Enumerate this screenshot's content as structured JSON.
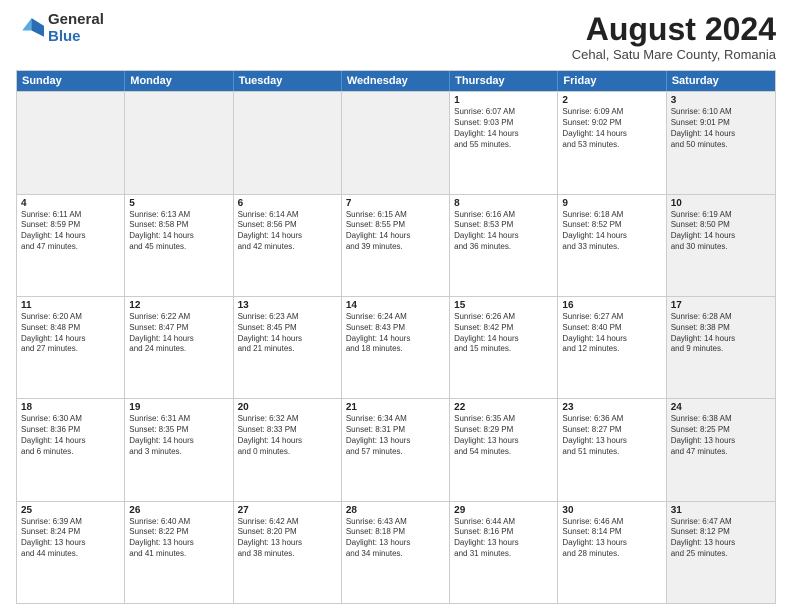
{
  "logo": {
    "general": "General",
    "blue": "Blue"
  },
  "title": "August 2024",
  "subtitle": "Cehal, Satu Mare County, Romania",
  "headers": [
    "Sunday",
    "Monday",
    "Tuesday",
    "Wednesday",
    "Thursday",
    "Friday",
    "Saturday"
  ],
  "weeks": [
    [
      {
        "day": "",
        "info": "",
        "shaded": true
      },
      {
        "day": "",
        "info": "",
        "shaded": true
      },
      {
        "day": "",
        "info": "",
        "shaded": true
      },
      {
        "day": "",
        "info": "",
        "shaded": true
      },
      {
        "day": "1",
        "info": "Sunrise: 6:07 AM\nSunset: 9:03 PM\nDaylight: 14 hours\nand 55 minutes."
      },
      {
        "day": "2",
        "info": "Sunrise: 6:09 AM\nSunset: 9:02 PM\nDaylight: 14 hours\nand 53 minutes."
      },
      {
        "day": "3",
        "info": "Sunrise: 6:10 AM\nSunset: 9:01 PM\nDaylight: 14 hours\nand 50 minutes.",
        "shaded": true
      }
    ],
    [
      {
        "day": "4",
        "info": "Sunrise: 6:11 AM\nSunset: 8:59 PM\nDaylight: 14 hours\nand 47 minutes."
      },
      {
        "day": "5",
        "info": "Sunrise: 6:13 AM\nSunset: 8:58 PM\nDaylight: 14 hours\nand 45 minutes."
      },
      {
        "day": "6",
        "info": "Sunrise: 6:14 AM\nSunset: 8:56 PM\nDaylight: 14 hours\nand 42 minutes."
      },
      {
        "day": "7",
        "info": "Sunrise: 6:15 AM\nSunset: 8:55 PM\nDaylight: 14 hours\nand 39 minutes."
      },
      {
        "day": "8",
        "info": "Sunrise: 6:16 AM\nSunset: 8:53 PM\nDaylight: 14 hours\nand 36 minutes."
      },
      {
        "day": "9",
        "info": "Sunrise: 6:18 AM\nSunset: 8:52 PM\nDaylight: 14 hours\nand 33 minutes."
      },
      {
        "day": "10",
        "info": "Sunrise: 6:19 AM\nSunset: 8:50 PM\nDaylight: 14 hours\nand 30 minutes.",
        "shaded": true
      }
    ],
    [
      {
        "day": "11",
        "info": "Sunrise: 6:20 AM\nSunset: 8:48 PM\nDaylight: 14 hours\nand 27 minutes."
      },
      {
        "day": "12",
        "info": "Sunrise: 6:22 AM\nSunset: 8:47 PM\nDaylight: 14 hours\nand 24 minutes."
      },
      {
        "day": "13",
        "info": "Sunrise: 6:23 AM\nSunset: 8:45 PM\nDaylight: 14 hours\nand 21 minutes."
      },
      {
        "day": "14",
        "info": "Sunrise: 6:24 AM\nSunset: 8:43 PM\nDaylight: 14 hours\nand 18 minutes."
      },
      {
        "day": "15",
        "info": "Sunrise: 6:26 AM\nSunset: 8:42 PM\nDaylight: 14 hours\nand 15 minutes."
      },
      {
        "day": "16",
        "info": "Sunrise: 6:27 AM\nSunset: 8:40 PM\nDaylight: 14 hours\nand 12 minutes."
      },
      {
        "day": "17",
        "info": "Sunrise: 6:28 AM\nSunset: 8:38 PM\nDaylight: 14 hours\nand 9 minutes.",
        "shaded": true
      }
    ],
    [
      {
        "day": "18",
        "info": "Sunrise: 6:30 AM\nSunset: 8:36 PM\nDaylight: 14 hours\nand 6 minutes."
      },
      {
        "day": "19",
        "info": "Sunrise: 6:31 AM\nSunset: 8:35 PM\nDaylight: 14 hours\nand 3 minutes."
      },
      {
        "day": "20",
        "info": "Sunrise: 6:32 AM\nSunset: 8:33 PM\nDaylight: 14 hours\nand 0 minutes."
      },
      {
        "day": "21",
        "info": "Sunrise: 6:34 AM\nSunset: 8:31 PM\nDaylight: 13 hours\nand 57 minutes."
      },
      {
        "day": "22",
        "info": "Sunrise: 6:35 AM\nSunset: 8:29 PM\nDaylight: 13 hours\nand 54 minutes."
      },
      {
        "day": "23",
        "info": "Sunrise: 6:36 AM\nSunset: 8:27 PM\nDaylight: 13 hours\nand 51 minutes."
      },
      {
        "day": "24",
        "info": "Sunrise: 6:38 AM\nSunset: 8:25 PM\nDaylight: 13 hours\nand 47 minutes.",
        "shaded": true
      }
    ],
    [
      {
        "day": "25",
        "info": "Sunrise: 6:39 AM\nSunset: 8:24 PM\nDaylight: 13 hours\nand 44 minutes."
      },
      {
        "day": "26",
        "info": "Sunrise: 6:40 AM\nSunset: 8:22 PM\nDaylight: 13 hours\nand 41 minutes."
      },
      {
        "day": "27",
        "info": "Sunrise: 6:42 AM\nSunset: 8:20 PM\nDaylight: 13 hours\nand 38 minutes."
      },
      {
        "day": "28",
        "info": "Sunrise: 6:43 AM\nSunset: 8:18 PM\nDaylight: 13 hours\nand 34 minutes."
      },
      {
        "day": "29",
        "info": "Sunrise: 6:44 AM\nSunset: 8:16 PM\nDaylight: 13 hours\nand 31 minutes."
      },
      {
        "day": "30",
        "info": "Sunrise: 6:46 AM\nSunset: 8:14 PM\nDaylight: 13 hours\nand 28 minutes."
      },
      {
        "day": "31",
        "info": "Sunrise: 6:47 AM\nSunset: 8:12 PM\nDaylight: 13 hours\nand 25 minutes.",
        "shaded": true
      }
    ]
  ]
}
